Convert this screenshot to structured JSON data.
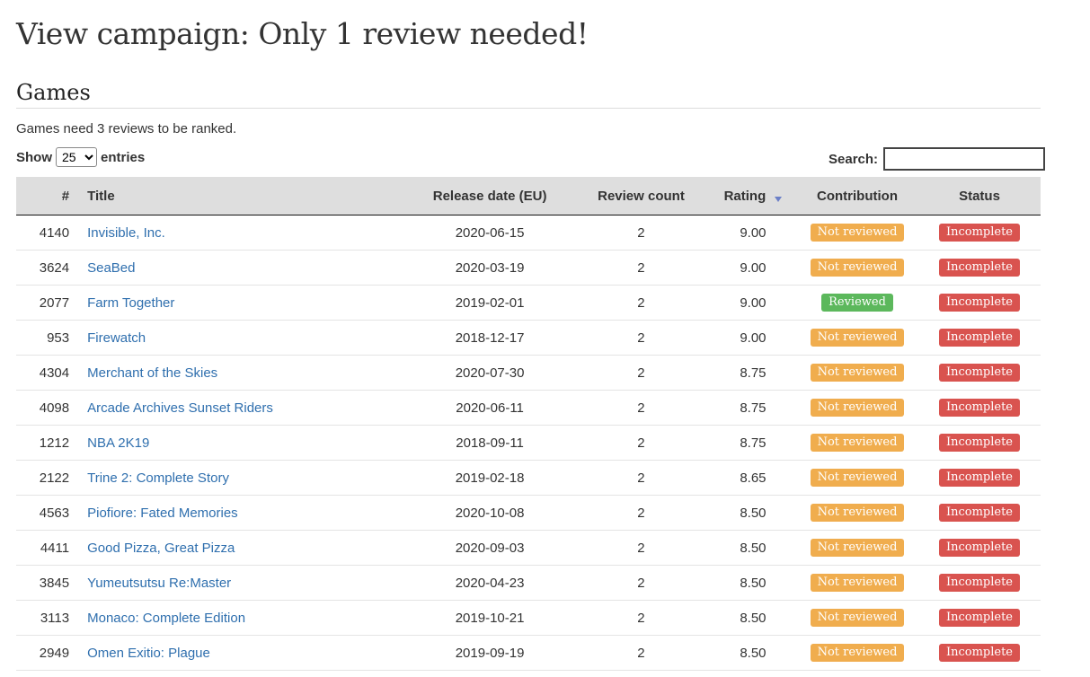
{
  "page": {
    "title": "View campaign: Only 1 review needed!",
    "section_title": "Games",
    "note": "Games need 3 reviews to be ranked."
  },
  "controls": {
    "show_label": "Show",
    "entries_value": "25",
    "entries_label": "entries",
    "search_label": "Search:",
    "search_value": ""
  },
  "table": {
    "headers": {
      "num": "#",
      "title": "Title",
      "release": "Release date (EU)",
      "count": "Review count",
      "rating": "Rating",
      "contribution": "Contribution",
      "status": "Status"
    },
    "rows": [
      {
        "num": "4140",
        "title": "Invisible, Inc.",
        "release": "2020-06-15",
        "count": "2",
        "rating": "9.00",
        "contribution": "Not reviewed",
        "status": "Incomplete"
      },
      {
        "num": "3624",
        "title": "SeaBed",
        "release": "2020-03-19",
        "count": "2",
        "rating": "9.00",
        "contribution": "Not reviewed",
        "status": "Incomplete"
      },
      {
        "num": "2077",
        "title": "Farm Together",
        "release": "2019-02-01",
        "count": "2",
        "rating": "9.00",
        "contribution": "Reviewed",
        "status": "Incomplete"
      },
      {
        "num": "953",
        "title": "Firewatch",
        "release": "2018-12-17",
        "count": "2",
        "rating": "9.00",
        "contribution": "Not reviewed",
        "status": "Incomplete"
      },
      {
        "num": "4304",
        "title": "Merchant of the Skies",
        "release": "2020-07-30",
        "count": "2",
        "rating": "8.75",
        "contribution": "Not reviewed",
        "status": "Incomplete"
      },
      {
        "num": "4098",
        "title": "Arcade Archives Sunset Riders",
        "release": "2020-06-11",
        "count": "2",
        "rating": "8.75",
        "contribution": "Not reviewed",
        "status": "Incomplete"
      },
      {
        "num": "1212",
        "title": "NBA 2K19",
        "release": "2018-09-11",
        "count": "2",
        "rating": "8.75",
        "contribution": "Not reviewed",
        "status": "Incomplete"
      },
      {
        "num": "2122",
        "title": "Trine 2: Complete Story",
        "release": "2019-02-18",
        "count": "2",
        "rating": "8.65",
        "contribution": "Not reviewed",
        "status": "Incomplete"
      },
      {
        "num": "4563",
        "title": "Piofiore: Fated Memories",
        "release": "2020-10-08",
        "count": "2",
        "rating": "8.50",
        "contribution": "Not reviewed",
        "status": "Incomplete"
      },
      {
        "num": "4411",
        "title": "Good Pizza, Great Pizza",
        "release": "2020-09-03",
        "count": "2",
        "rating": "8.50",
        "contribution": "Not reviewed",
        "status": "Incomplete"
      },
      {
        "num": "3845",
        "title": "Yumeutsutsu Re:Master",
        "release": "2020-04-23",
        "count": "2",
        "rating": "8.50",
        "contribution": "Not reviewed",
        "status": "Incomplete"
      },
      {
        "num": "3113",
        "title": "Monaco: Complete Edition",
        "release": "2019-10-21",
        "count": "2",
        "rating": "8.50",
        "contribution": "Not reviewed",
        "status": "Incomplete"
      },
      {
        "num": "2949",
        "title": "Omen Exitio: Plague",
        "release": "2019-09-19",
        "count": "2",
        "rating": "8.50",
        "contribution": "Not reviewed",
        "status": "Incomplete"
      }
    ]
  },
  "colors": {
    "link": "#2f6fae",
    "not_reviewed": "#f0ad4e",
    "reviewed": "#5cb85c",
    "incomplete": "#d9534f"
  }
}
